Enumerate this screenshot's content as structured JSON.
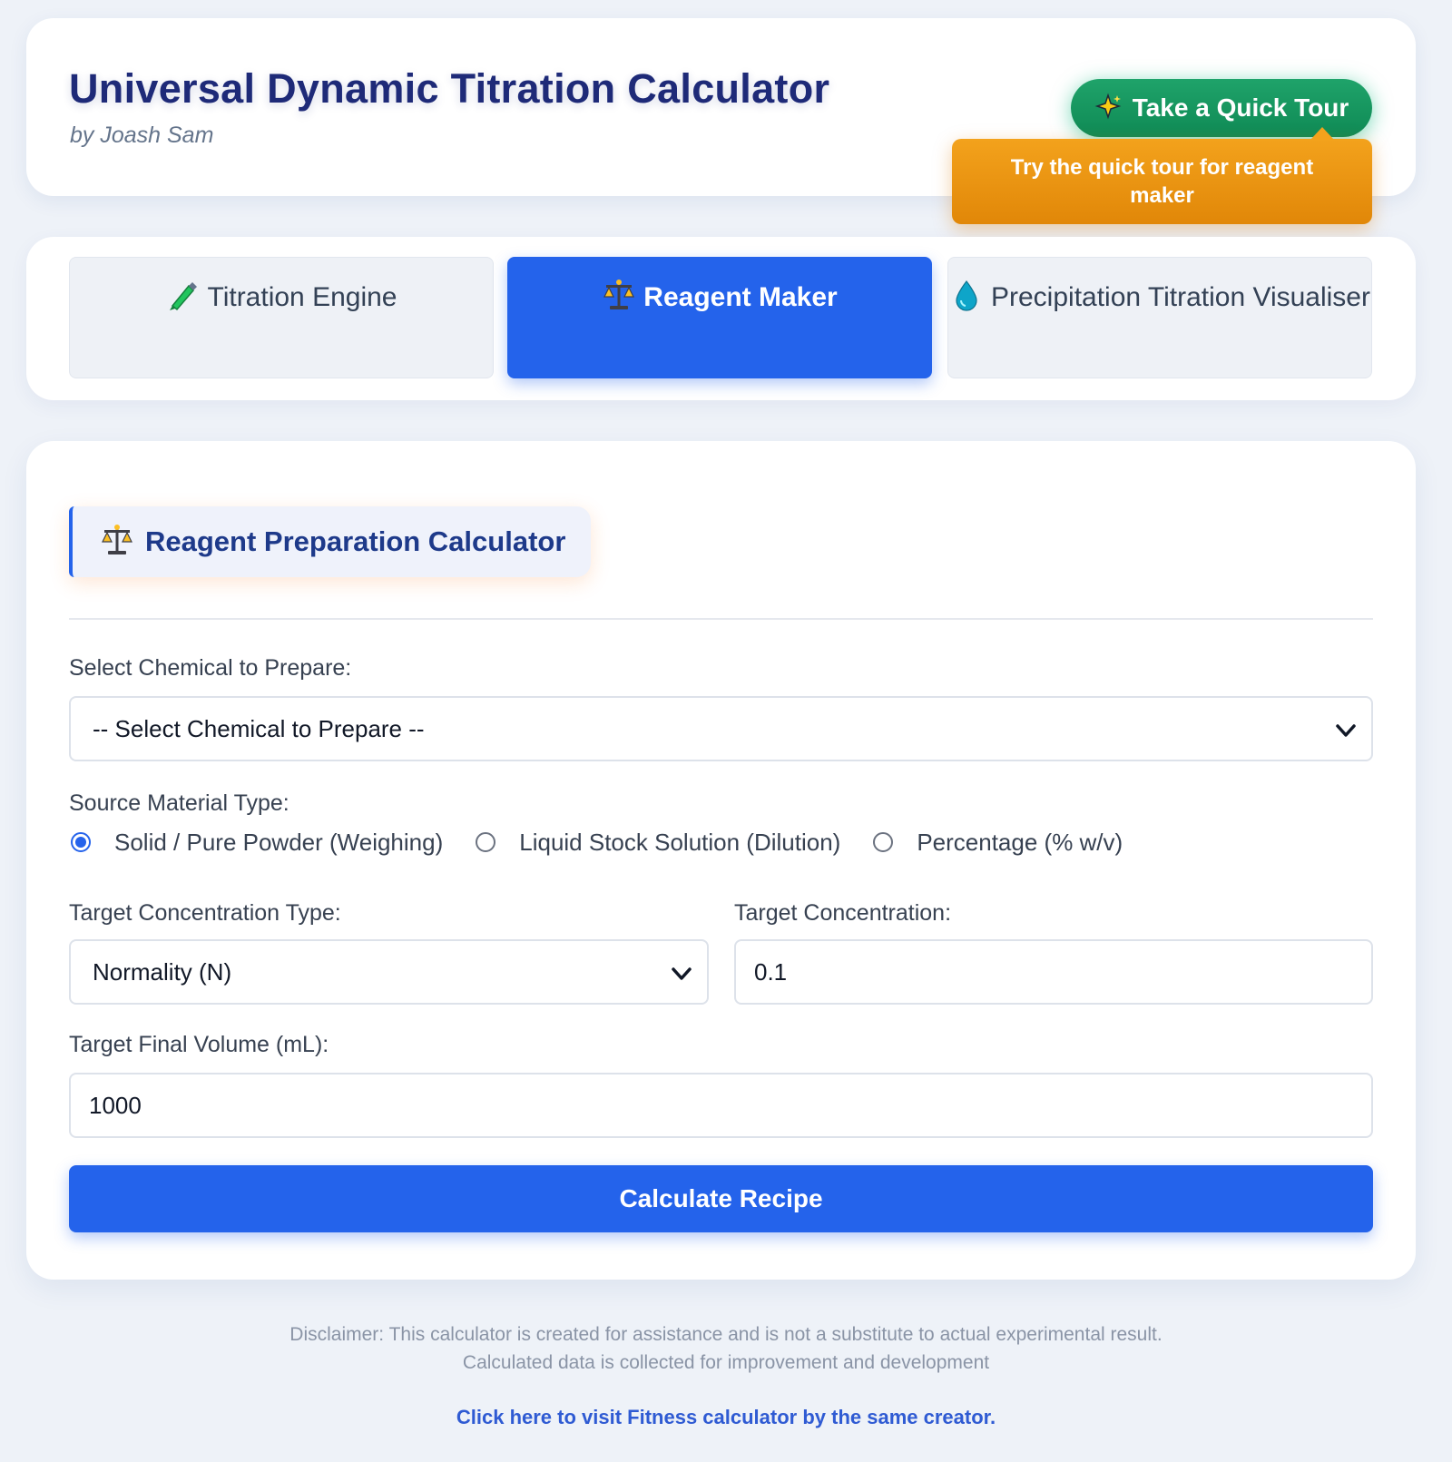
{
  "header": {
    "title": "Universal Dynamic Titration Calculator",
    "byline": "by Joash Sam",
    "tour_button": {
      "icon": "sparkles-icon",
      "label": "Take a Quick Tour"
    },
    "tour_tooltip": "Try the quick tour for reagent maker"
  },
  "tabs": [
    {
      "icon": "pipette-icon",
      "label": "Titration Engine",
      "active": false
    },
    {
      "icon": "balance-scale-icon",
      "label": "Reagent Maker",
      "active": true
    },
    {
      "icon": "droplet-icon",
      "label": "Precipitation Titration Visualiser",
      "active": false
    }
  ],
  "section": {
    "icon": "balance-scale-icon",
    "title": "Reagent Preparation Calculator"
  },
  "form": {
    "chemical_label": "Select Chemical to Prepare:",
    "chemical_value": "-- Select Chemical to Prepare --",
    "source_label": "Source Material Type:",
    "source_options": [
      {
        "label": "Solid / Pure Powder (Weighing)",
        "checked": true
      },
      {
        "label": "Liquid Stock Solution (Dilution)",
        "checked": false
      },
      {
        "label": "Percentage (% w/v)",
        "checked": false
      }
    ],
    "conc_type_label": "Target Concentration Type:",
    "conc_type_value": "Normality (N)",
    "conc_label": "Target Concentration:",
    "conc_value": "0.1",
    "volume_label": "Target Final Volume (mL):",
    "volume_value": "1000",
    "calculate_label": "Calculate Recipe"
  },
  "footer": {
    "disclaimer_line1": "Disclaimer: This calculator is created for assistance and is not a substitute to actual experimental result.",
    "disclaimer_line2": "Calculated data is collected for improvement and development",
    "link_text": "Click here to visit Fitness calculator by the same creator."
  },
  "colors": {
    "primary": "#2463eb",
    "title": "#1e2a78",
    "tour_green": "#0f8a55",
    "tooltip_orange": "#e18708",
    "page_bg": "#eef2f8"
  }
}
